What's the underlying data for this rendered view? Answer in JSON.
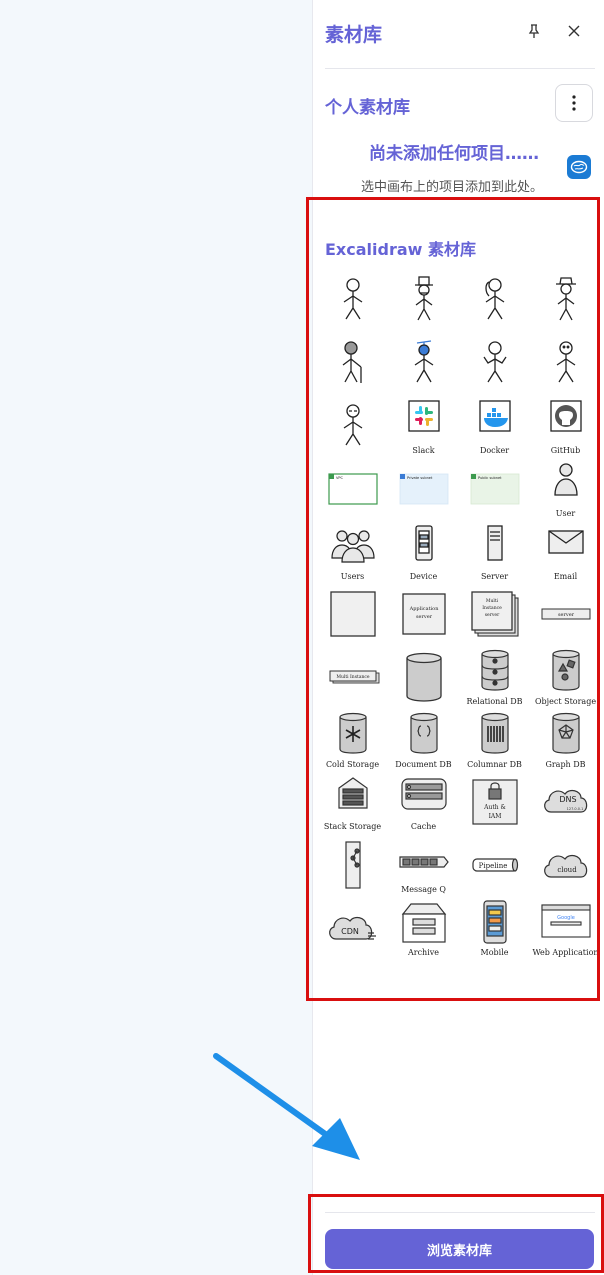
{
  "panel": {
    "title": "素材库",
    "personal": {
      "title": "个人素材库",
      "empty_title": "尚未添加任何项目……",
      "empty_hint": "选中画布上的项目添加到此处。"
    },
    "library": {
      "title": "Excalidraw 素材库",
      "items": [
        {
          "icon": "stick-figure",
          "label": ""
        },
        {
          "icon": "stick-figure-top-hat",
          "label": ""
        },
        {
          "icon": "stick-figure-ponytail",
          "label": ""
        },
        {
          "icon": "stick-figure-fedora",
          "label": ""
        },
        {
          "icon": "stick-figure-cane",
          "label": ""
        },
        {
          "icon": "stick-figure-propeller",
          "label": ""
        },
        {
          "icon": "stick-figure-shrug",
          "label": ""
        },
        {
          "icon": "stick-figure-curly",
          "label": ""
        },
        {
          "icon": "stick-figure-glasses",
          "label": ""
        },
        {
          "icon": "slack-logo",
          "label": "Slack"
        },
        {
          "icon": "docker-logo",
          "label": "Docker"
        },
        {
          "icon": "github-logo",
          "label": "GitHub"
        },
        {
          "icon": "vpc-box",
          "label": ""
        },
        {
          "icon": "private-subnet-box",
          "label": ""
        },
        {
          "icon": "public-subnet-box",
          "label": ""
        },
        {
          "icon": "user",
          "label": "User"
        },
        {
          "icon": "users",
          "label": "Users"
        },
        {
          "icon": "device",
          "label": "Device"
        },
        {
          "icon": "server",
          "label": "Server"
        },
        {
          "icon": "email",
          "label": "Email"
        },
        {
          "icon": "blank-square",
          "label": ""
        },
        {
          "icon": "application-server",
          "label": "Application server"
        },
        {
          "icon": "multi-instance-server",
          "label": "Multi Instance server"
        },
        {
          "icon": "server-bar",
          "label": "server"
        },
        {
          "icon": "multi-instance-bar",
          "label": "Multi Instance"
        },
        {
          "icon": "storage-cylinder",
          "label": ""
        },
        {
          "icon": "relational-db",
          "label": "Relational DB"
        },
        {
          "icon": "object-storage",
          "label": "Object Storage"
        },
        {
          "icon": "cold-storage",
          "label": "Cold Storage"
        },
        {
          "icon": "document-db",
          "label": "Document DB"
        },
        {
          "icon": "columnar-db",
          "label": "Columnar DB"
        },
        {
          "icon": "graph-db",
          "label": "Graph DB"
        },
        {
          "icon": "stack-storage",
          "label": "Stack Storage"
        },
        {
          "icon": "cache",
          "label": "Cache"
        },
        {
          "icon": "auth-iam",
          "label": "Auth & IAM"
        },
        {
          "icon": "dns",
          "label": ""
        },
        {
          "icon": "load-balancer",
          "label": ""
        },
        {
          "icon": "message-queue",
          "label": "Message Q"
        },
        {
          "icon": "pipeline",
          "label": ""
        },
        {
          "icon": "cloud",
          "label": ""
        },
        {
          "icon": "cdn",
          "label": ""
        },
        {
          "icon": "archive",
          "label": "Archive"
        },
        {
          "icon": "mobile",
          "label": "Mobile"
        },
        {
          "icon": "web-application",
          "label": "Web Application"
        }
      ]
    },
    "browse_button": "浏览素材库"
  },
  "inline_texts": {
    "private_subnet": "Private subnet",
    "public_subnet": "Public subnet",
    "vpc": "VPC",
    "application": "Application",
    "server": "server",
    "multi": "Multi",
    "instance": "Instance",
    "dns": "DNS",
    "dns_ip": "127.0.0.1",
    "auth": "Auth &",
    "iam": "IAM",
    "pipeline": "Pipeline",
    "cloud": "cloud",
    "cdn": "CDN",
    "google": "Google"
  },
  "colors": {
    "accent": "#6563d6",
    "highlight": "#d90f0f",
    "arrow": "#1e8fe8"
  }
}
